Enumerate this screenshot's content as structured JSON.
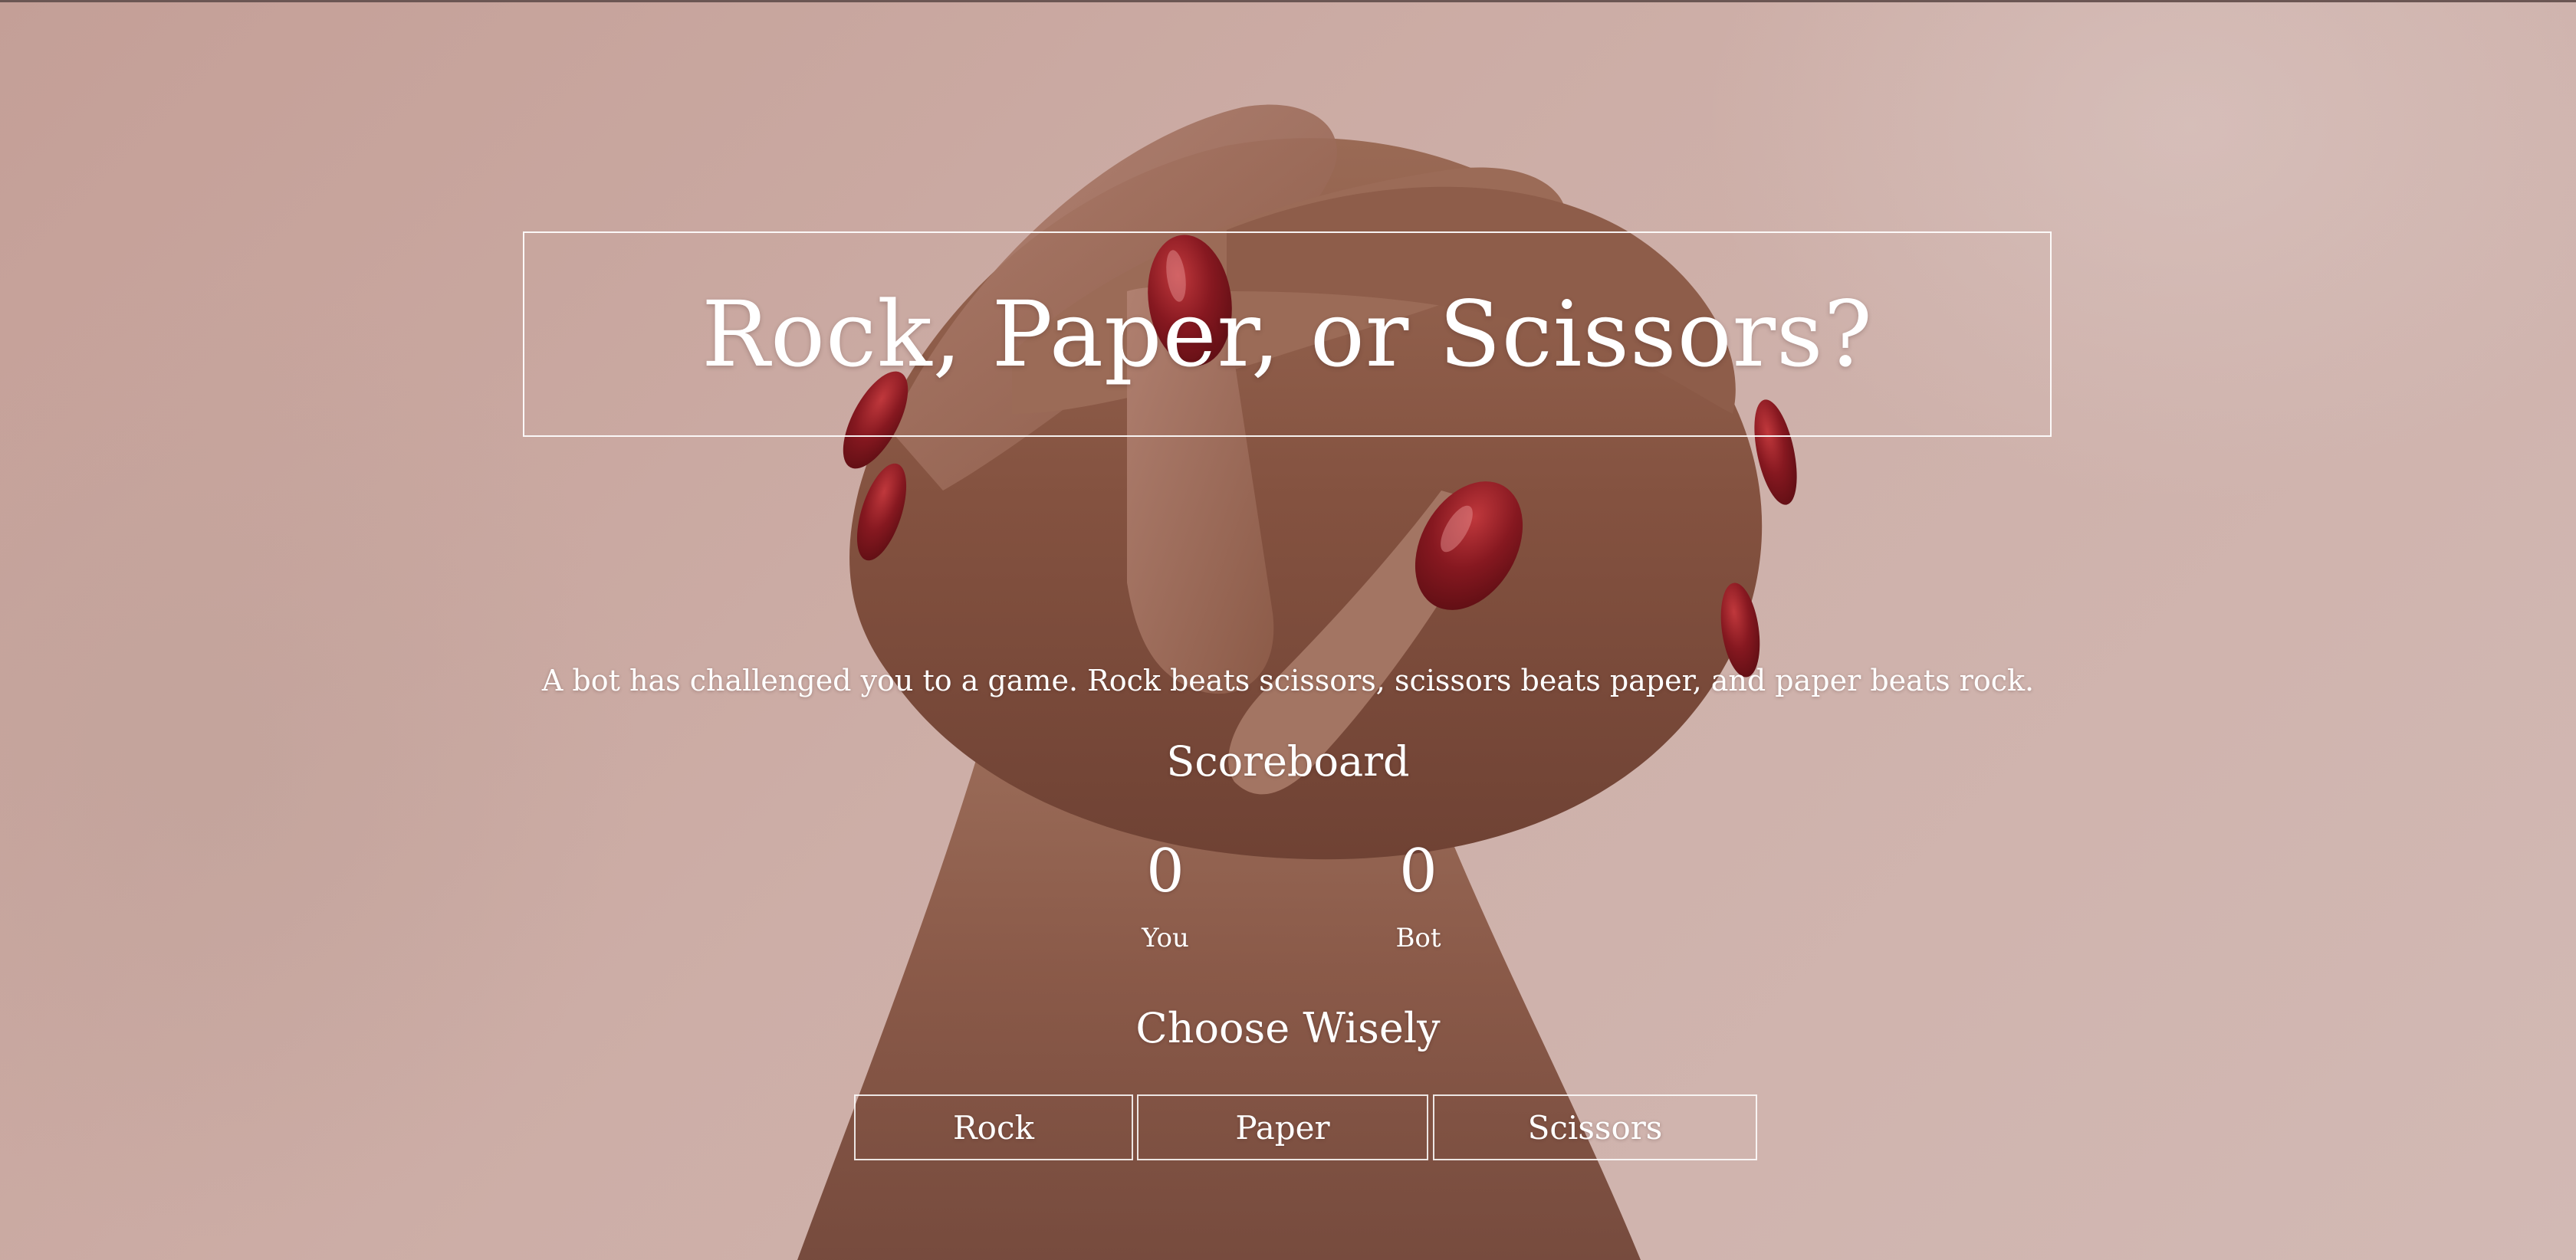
{
  "page": {
    "title": "Rock, Paper, or Scissors?",
    "intro": "A bot has challenged you to a game. Rock beats scissors, scissors beats paper, and paper beats rock.",
    "background_image": "clasped-hands-photo"
  },
  "scoreboard": {
    "heading": "Scoreboard",
    "you": {
      "score": "0",
      "label": "You"
    },
    "bot": {
      "score": "0",
      "label": "Bot"
    }
  },
  "choices": {
    "heading": "Choose Wisely",
    "buttons": [
      "Rock",
      "Paper",
      "Scissors"
    ]
  },
  "colors": {
    "text": "#ffffff",
    "background": "#c9ada7",
    "nail_polish": "#7a1418",
    "skin": "#8a5a45"
  }
}
